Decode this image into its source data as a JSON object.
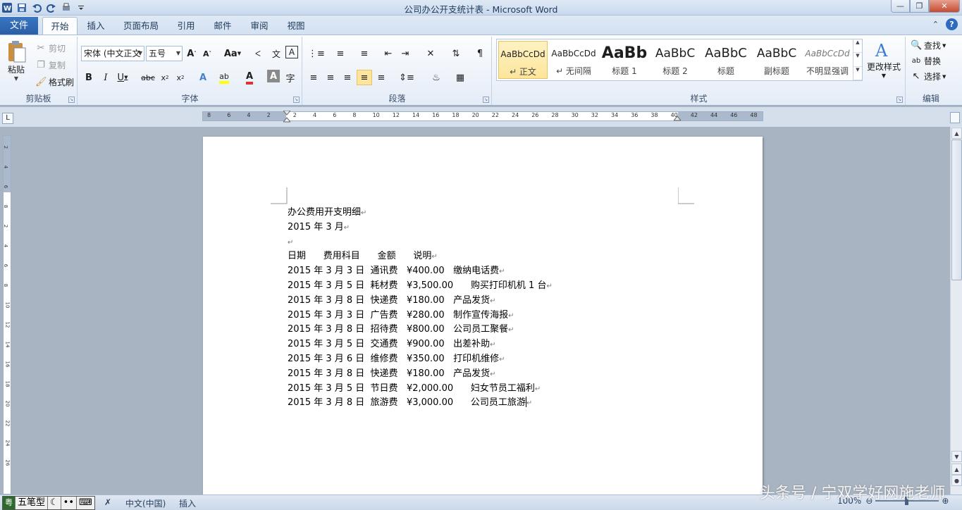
{
  "window": {
    "title": "公司办公开支统计表 - Microsoft Word"
  },
  "tabs": [
    "文件",
    "开始",
    "插入",
    "页面布局",
    "引用",
    "邮件",
    "审阅",
    "视图"
  ],
  "clipboard": {
    "paste": "粘贴",
    "cut": "剪切",
    "copy": "复制",
    "format_painter": "格式刷",
    "label": "剪贴板"
  },
  "font_group": {
    "font_name": "宋体 (中文正文",
    "font_size": "五号",
    "label": "字体"
  },
  "paragraph_group": {
    "label": "段落"
  },
  "styles_group": {
    "label": "样式",
    "items": [
      {
        "sample": "AaBbCcDd",
        "name": "↵ 正文"
      },
      {
        "sample": "AaBbCcDd",
        "name": "↵ 无间隔"
      },
      {
        "sample": "AaBb",
        "name": "标题 1"
      },
      {
        "sample": "AaBbC",
        "name": "标题 2"
      },
      {
        "sample": "AaBbC",
        "name": "标题"
      },
      {
        "sample": "AaBbC",
        "name": "副标题"
      },
      {
        "sample": "AaBbCcDd",
        "name": "不明显强调"
      }
    ],
    "change_styles": "更改样式"
  },
  "editing_group": {
    "find": "查找",
    "replace": "替换",
    "select": "选择",
    "label": "编辑"
  },
  "ruler": {
    "ticks": [
      "8",
      "6",
      "4",
      "2",
      "2",
      "4",
      "6",
      "8",
      "10",
      "12",
      "14",
      "16",
      "18",
      "20",
      "22",
      "24",
      "26",
      "28",
      "30",
      "32",
      "34",
      "36",
      "38",
      "40",
      "42",
      "44",
      "46",
      "48"
    ]
  },
  "document": {
    "lines": [
      "办公费用开支明细",
      "2015 年 3 月",
      "",
      "日期      费用科目      金额      说明",
      "2015 年 3 月 3 日  通讯费   ¥400.00   缴纳电话费",
      "2015 年 3 月 5 日  耗材费   ¥3,500.00      购买打印机机 1 台",
      "2015 年 3 月 8 日  快递费   ¥180.00   产品发货",
      "2015 年 3 月 3 日  广告费   ¥280.00   制作宣传海报",
      "2015 年 3 月 8 日  招待费   ¥800.00   公司员工聚餐",
      "2015 年 3 月 5 日  交通费   ¥900.00   出差补助",
      "2015 年 3 月 6 日  维修费   ¥350.00   打印机维修",
      "2015 年 3 月 8 日  快递费   ¥180.00   产品发货",
      "2015 年 3 月 5 日  节日费   ¥2,000.00      妇女节员工福利",
      "2015 年 3 月 8 日  旅游费   ¥3,000.00      公司员工旅游"
    ]
  },
  "statusbar": {
    "ime_mode": "五笔型",
    "language": "中文(中国)",
    "insert_mode": "插入",
    "zoom": "100%"
  },
  "watermark": "头条号 / 宁双学好网施老师"
}
